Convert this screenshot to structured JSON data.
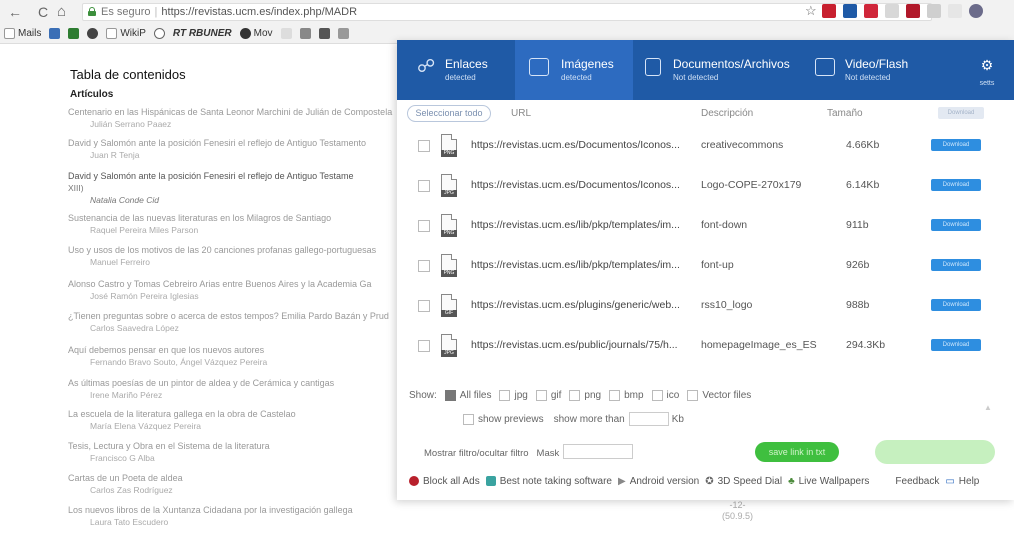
{
  "browser": {
    "back": "←",
    "reload": "C",
    "home": "⌂",
    "secure_label": "Es seguro",
    "url": "https://revistas.ucm.es/index.php/MADR",
    "bookmarks": [
      "Mails",
      "",
      "",
      "",
      "WikiP",
      "",
      "RT RBUNER",
      "Mov",
      ""
    ]
  },
  "page": {
    "toc_title": "Tabla de contenidos",
    "section": "Artículos",
    "articles": [
      {
        "title": "Centenario en las Hispánicas de Santa Leonor Marchini de Julián de Compostela",
        "author": "Julián Serrano Paaez"
      },
      {
        "title": "David y Salomón ante la posición Fenesiri el reflejo de Antiguo Testamento",
        "author": "Juan R Tenja"
      },
      {
        "title": "David y Salomón ante la posición Fenesiri el reflejo de Antiguo Testame",
        "sub": "XIII)",
        "author": "Natalia Conde Cid",
        "clear": true
      },
      {
        "title": "Sustenancia de las nuevas literaturas en los Milagros de Santiago",
        "author": "Raquel Pereira Miles Parson"
      },
      {
        "title": "Uso y usos de los motivos de las 20 canciones profanas gallego-portuguesas",
        "author": "Manuel Ferreiro"
      },
      {
        "title": "Alonso Castro y Tomas Cebreiro Arias entre Buenos Aires y la Academia Ga",
        "author": "José Ramón Pereira Iglesias"
      },
      {
        "title": "¿Tienen preguntas sobre o acerca de estos tempos? Emilia Pardo Bazán y Prud",
        "author": "Carlos Saavedra López"
      },
      {
        "title": "Aquí debemos pensar en que los nuevos autores",
        "author": "Fernando Bravo Souto, Ángel Vázquez Pereira"
      },
      {
        "title": "As últimas poesías de un pintor de aldea y de Cerámica y cantigas",
        "author": "Irene Mariño Pérez"
      },
      {
        "title": "La escuela de la literatura gallega en la obra de Castelao",
        "author": "María Elena Vázquez Pereira"
      },
      {
        "title": "Tesis, Lectura y Obra en el Sistema de la literatura",
        "author": "Francisco G Alba"
      },
      {
        "title": "Cartas de un Poeta de aldea",
        "author": "Carlos Zas Rodríguez"
      },
      {
        "title": "Los nuevos libros de la Xuntanza Cidadana por la investigación gallega",
        "author": "Laura Tato Escudero"
      }
    ],
    "fold_number": "-12-\n(50.9.5)"
  },
  "popup": {
    "tabs": [
      {
        "label": "Enlaces",
        "sub": "detected"
      },
      {
        "label": "Imágenes",
        "sub": "detected"
      },
      {
        "label": "Documentos/Archivos",
        "sub": "Not detected"
      },
      {
        "label": "Video/Flash",
        "sub": "Not detected"
      }
    ],
    "settings_label": "setts",
    "select_all": "Seleccionar todo",
    "columns": {
      "url": "URL",
      "description": "Descripción",
      "size": "Tamaño",
      "download": "Download"
    },
    "rows": [
      {
        "type": "PNG",
        "url": "https://revistas.ucm.es/Documentos/Iconos...",
        "desc": "creativecommons",
        "size": "4.66Kb"
      },
      {
        "type": "JPG",
        "url": "https://revistas.ucm.es/Documentos/Iconos...",
        "desc": "Logo-COPE-270x179",
        "size": "6.14Kb"
      },
      {
        "type": "PNG",
        "url": "https://revistas.ucm.es/lib/pkp/templates/im...",
        "desc": "font-down",
        "size": "911b"
      },
      {
        "type": "PNG",
        "url": "https://revistas.ucm.es/lib/pkp/templates/im...",
        "desc": "font-up",
        "size": "926b"
      },
      {
        "type": "GIF",
        "url": "https://revistas.ucm.es/plugins/generic/web...",
        "desc": "rss10_logo",
        "size": "988b"
      },
      {
        "type": "JPG",
        "url": "https://revistas.ucm.es/public/journals/75/h...",
        "desc": "homepageImage_es_ES",
        "size": "294.3Kb"
      }
    ],
    "download_btn": "Download",
    "filters": {
      "show_label": "Show:",
      "types": [
        "All files",
        "jpg",
        "gif",
        "png",
        "bmp",
        "ico",
        "Vector files"
      ],
      "show_previews": "show previews",
      "show_more_than": "show more than",
      "kb": "Kb"
    },
    "mostrar": "Mostrar filtro/ocultar filtro",
    "mask": "Mask",
    "save_link": "save link in txt",
    "footer": [
      "Block all Ads",
      "Best note taking software",
      "Android version",
      "3D Speed Dial",
      "Live Wallpapers",
      "Feedback",
      "Help"
    ]
  }
}
